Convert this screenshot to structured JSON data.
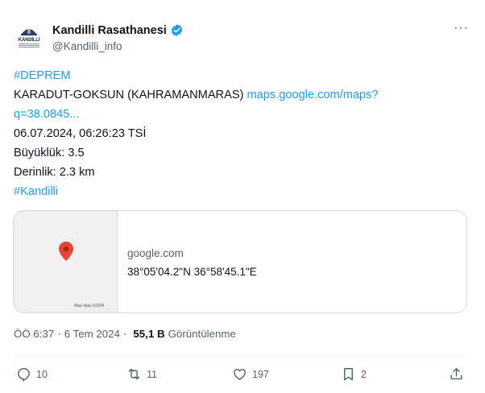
{
  "author": {
    "display_name": "Kandilli Rasathanesi",
    "handle": "@Kandilli_info",
    "avatar_text": "KANDİLLİ"
  },
  "tweet": {
    "hashtag_top": "#DEPREM",
    "location": "KARADUT-GOKSUN (KAHRAMANMARAS)",
    "link_part1": "maps.google.com/maps?",
    "link_part2": "q=38.0845...",
    "datetime": "06.07.2024, 06:26:23 TSİ",
    "magnitude": "Büyüklük: 3.5",
    "depth": "Derinlik: 2.3 km",
    "hashtag_bottom": "#Kandilli"
  },
  "card": {
    "domain": "google.com",
    "title": "38°05'04.2\"N 36°58'45.1\"E",
    "map_credit": "Map data ©2024"
  },
  "meta": {
    "time": "ÖÖ 6:37",
    "separator": "·",
    "date": "6 Tem 2024",
    "views_count": "55,1 B",
    "views_label": "Görüntülenme"
  },
  "actions": {
    "replies": "10",
    "reposts": "11",
    "likes": "197",
    "bookmarks": "2"
  },
  "colors": {
    "link": "#1d9bf0",
    "secondary_text": "#536471",
    "pin": "#ea4335"
  },
  "icons": [
    "more-icon",
    "verified-icon",
    "map-pin-icon",
    "reply-icon",
    "repost-icon",
    "like-icon",
    "bookmark-icon",
    "share-icon"
  ]
}
